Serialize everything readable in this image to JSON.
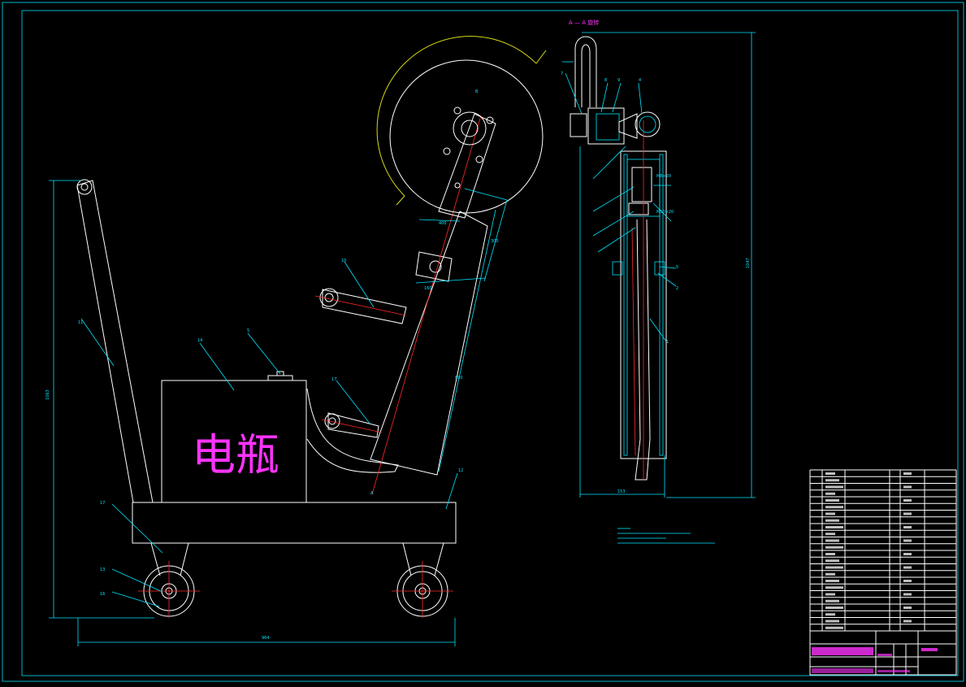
{
  "battery_label": "电瓶",
  "section_title": "A — A 旋转",
  "colors": {
    "background": "#000000",
    "outline": "#ffffff",
    "dimension": "#00e5ff",
    "centerline": "#ff2a2a",
    "blade_guard": "#d8d81a",
    "label_magenta": "#ff33ff"
  }
}
